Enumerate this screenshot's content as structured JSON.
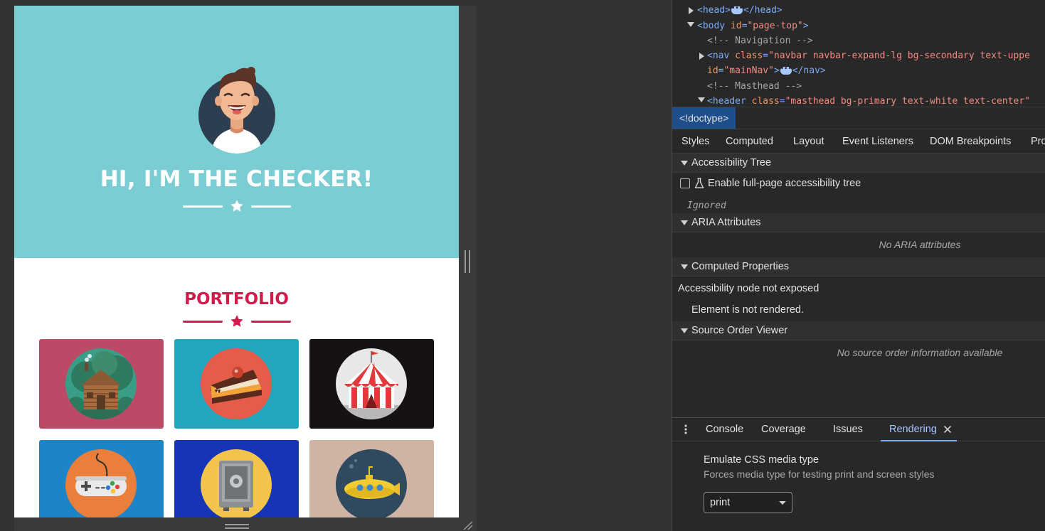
{
  "page": {
    "hero_title": "HI, I'M THE CHECKER!",
    "portfolio_title": "PORTFOLIO",
    "colors": {
      "masthead": "#7acdd3",
      "accent": "#d4194b"
    },
    "portfolio_items": [
      {
        "icon": "log-cabin-icon",
        "bg": "#bc4a66"
      },
      {
        "icon": "cake-slice-icon",
        "bg": "#22a5bd"
      },
      {
        "icon": "circus-tent-icon",
        "bg": "#161211"
      },
      {
        "icon": "game-controller-icon",
        "bg": "#1d84c7"
      },
      {
        "icon": "safe-icon",
        "bg": "#1534b6"
      },
      {
        "icon": "submarine-icon",
        "bg": "#cfb4a6"
      }
    ]
  },
  "devtools": {
    "tree": {
      "head_open": "<head>",
      "head_close": "</head>",
      "body_tag": "<body",
      "body_id_attr": "id",
      "body_id_val": "\"page-top\"",
      "body_end": ">",
      "comment_nav": "<!-- Navigation -->",
      "nav_tag": "<nav",
      "nav_class_attr": "class",
      "nav_class_val": "\"navbar navbar-expand-lg bg-secondary text-uppe",
      "nav_id_attr": "id",
      "nav_id_val": "\"mainNav\"",
      "nav_end": ">",
      "nav_close": "</nav>",
      "comment_masthead": "<!-- Masthead -->",
      "header_tag": "<header",
      "header_class_attr": "class",
      "header_class_val": "\"masthead bg-primary text-white text-center\""
    },
    "breadcrumb": "<!doctype>",
    "subtabs": [
      "Styles",
      "Computed",
      "Layout",
      "Event Listeners",
      "DOM Breakpoints",
      "Pro"
    ],
    "accessibility_tree": {
      "title": "Accessibility Tree",
      "checkbox_label": "Enable full-page accessibility tree",
      "checkbox_checked": false,
      "ignored": "Ignored"
    },
    "aria": {
      "title": "ARIA Attributes",
      "empty": "No ARIA attributes"
    },
    "computed_properties": {
      "title": "Computed Properties",
      "line1": "Accessibility node not exposed",
      "line2": "Element is not rendered."
    },
    "source_order": {
      "title": "Source Order Viewer",
      "empty": "No source order information available"
    },
    "drawer": {
      "tabs": [
        "Console",
        "Coverage",
        "Issues",
        "Rendering"
      ],
      "active_tab": "Rendering",
      "emulate_title": "Emulate CSS media type",
      "emulate_desc": "Forces media type for testing print and screen styles",
      "media_type_value": "print"
    }
  }
}
